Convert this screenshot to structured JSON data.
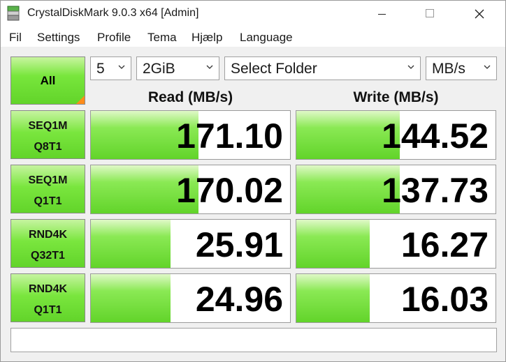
{
  "window": {
    "title": "CrystalDiskMark 9.0.3 x64 [Admin]"
  },
  "menu": [
    "Fil",
    "Settings",
    "Profile",
    "Tema",
    "Hjælp",
    "Language"
  ],
  "controls": {
    "all_label": "All",
    "count": "5",
    "size": "2GiB",
    "folder": "Select Folder",
    "unit": "MB/s"
  },
  "headers": {
    "read": "Read (MB/s)",
    "write": "Write (MB/s)"
  },
  "tests": [
    {
      "line1": "SEQ1M",
      "line2": "Q8T1",
      "read": "171.10",
      "write": "144.52",
      "read_level": 0.54,
      "write_level": 0.52
    },
    {
      "line1": "SEQ1M",
      "line2": "Q1T1",
      "read": "170.02",
      "write": "137.73",
      "read_level": 0.54,
      "write_level": 0.52
    },
    {
      "line1": "RND4K",
      "line2": "Q32T1",
      "read": "25.91",
      "write": "16.27",
      "read_level": 0.4,
      "write_level": 0.37
    },
    {
      "line1": "RND4K",
      "line2": "Q1T1",
      "read": "24.96",
      "write": "16.03",
      "read_level": 0.4,
      "write_level": 0.37
    }
  ],
  "comment": "",
  "colors": {
    "accent_green": "#62d42a",
    "corner_orange": "#ff8c1a"
  }
}
